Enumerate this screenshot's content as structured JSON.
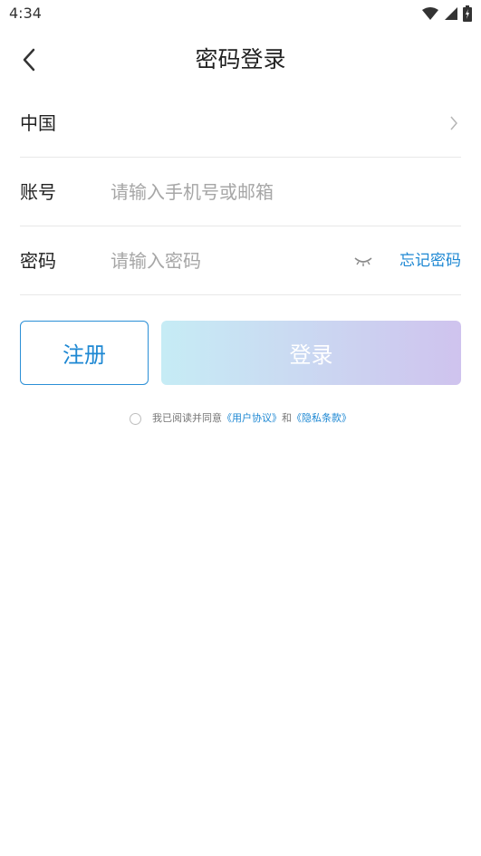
{
  "status_bar": {
    "time": "4:34"
  },
  "header": {
    "title": "密码登录",
    "back_icon": "back-arrow-icon"
  },
  "region_row": {
    "label": "中国",
    "icon": "chevron-right-icon"
  },
  "account_row": {
    "label": "账号",
    "placeholder": "请输入手机号或邮箱",
    "value": ""
  },
  "password_row": {
    "label": "密码",
    "placeholder": "请输入密码",
    "value": "",
    "eye_icon": "eye-closed-icon",
    "forgot_label": "忘记密码"
  },
  "buttons": {
    "register_label": "注册",
    "login_label": "登录"
  },
  "agreement": {
    "prefix": "我已阅读并同意",
    "user_agreement": "《用户协议》",
    "and": "和",
    "privacy_policy": "《隐私条款》",
    "checked": false
  },
  "colors": {
    "accent": "#1e88d3",
    "login_gradient_start": "#c6ecf5",
    "login_gradient_end": "#cfc3ee",
    "divider": "#e8e8e8",
    "placeholder": "#a6a6a6"
  }
}
